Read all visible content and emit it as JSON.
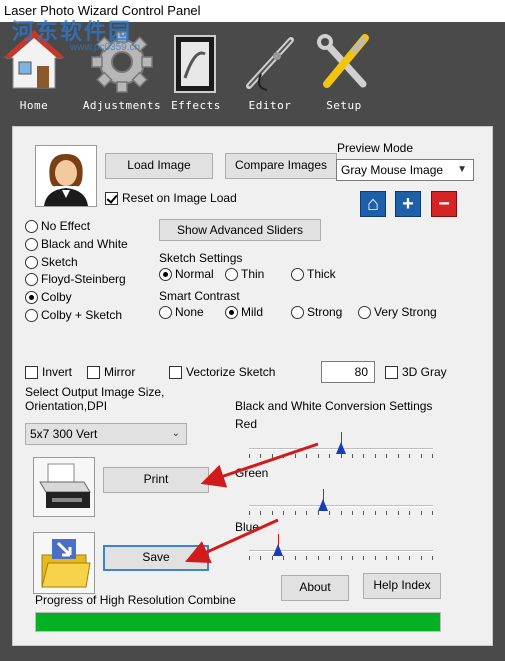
{
  "window": {
    "title": "Laser Photo Wizard Control Panel"
  },
  "watermark": {
    "text": "河东软件园",
    "url": "www.pc0359.cn"
  },
  "toolbar": {
    "items": [
      {
        "label": "Home",
        "icon": "house-icon"
      },
      {
        "label": "Adjustments",
        "icon": "gear-icon"
      },
      {
        "label": "Effects",
        "icon": "book-icon"
      },
      {
        "label": "Editor",
        "icon": "airbrush-icon"
      },
      {
        "label": "Setup",
        "icon": "tools-icon"
      }
    ]
  },
  "buttons": {
    "load_image": "Load Image",
    "compare_images": "Compare Images",
    "show_advanced_sliders": "Show Advanced Sliders",
    "print": "Print",
    "save": "Save",
    "about": "About",
    "help_index": "Help Index"
  },
  "preview": {
    "label": "Preview Mode",
    "selected": "Gray Mouse Image",
    "home_symbol": "⌂",
    "plus_symbol": "+",
    "minus_symbol": "−"
  },
  "reset_on_load": {
    "label": "Reset on Image Load",
    "checked": true
  },
  "effects": [
    {
      "label": "No Effect",
      "checked": false
    },
    {
      "label": "Black and White",
      "checked": false
    },
    {
      "label": "Sketch",
      "checked": false
    },
    {
      "label": "Floyd-Steinberg",
      "checked": false
    },
    {
      "label": "Colby",
      "checked": true
    },
    {
      "label": "Colby  + Sketch",
      "checked": false
    }
  ],
  "sketch_settings": {
    "label": "Sketch Settings",
    "options": [
      {
        "label": "Normal",
        "checked": true
      },
      {
        "label": "Thin",
        "checked": false
      },
      {
        "label": "Thick",
        "checked": false
      }
    ]
  },
  "smart_contrast": {
    "label": "Smart Contrast",
    "options": [
      {
        "label": "None",
        "checked": false
      },
      {
        "label": "Mild",
        "checked": true
      },
      {
        "label": "Strong",
        "checked": false
      },
      {
        "label": "Very Strong",
        "checked": false
      }
    ]
  },
  "toggles": {
    "invert": "Invert",
    "mirror": "Mirror",
    "vectorize": "Vectorize Sketch",
    "gray3d": "3D Gray"
  },
  "sketch_value": "80",
  "output": {
    "label": "Select Output Image Size,\nOrientation,DPI",
    "selected": "5x7 300 Vert"
  },
  "bw_conversion": {
    "label": "Black and White Conversion Settings",
    "red_label": "Red",
    "green_label": "Green",
    "blue_label": "Blue",
    "red": 0.5,
    "green": 0.4,
    "blue": 0.16
  },
  "progress": {
    "label": "Progress of High Resolution Combine",
    "value": 1.0
  },
  "colors": {
    "accent": "#1d5fa8",
    "progress": "#06b025",
    "arrow": "#d11a1a"
  }
}
